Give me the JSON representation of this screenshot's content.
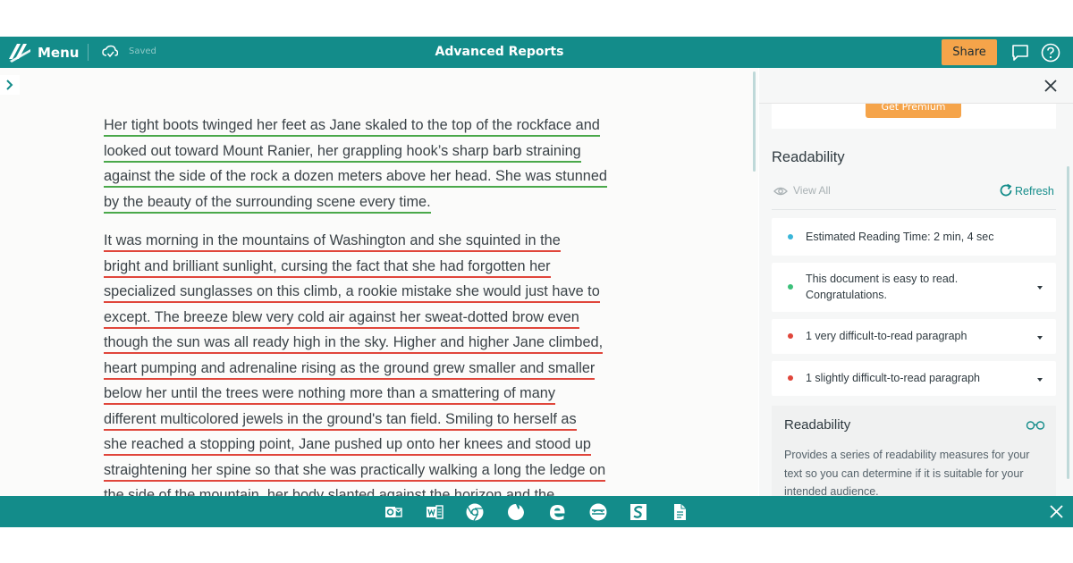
{
  "header": {
    "menu_label": "Menu",
    "saved_label": "Saved",
    "doc_title": "Advanced Reports",
    "share_label": "Share",
    "icons": [
      "logo-icon",
      "cloud-check-icon",
      "chat-icon",
      "help-icon"
    ]
  },
  "document": {
    "paragraphs": [
      {
        "status": "easy",
        "underline_color": "#4aa84a",
        "lines": [
          "Her tight boots twinged her feet as Jane skaled to the top of the rockface and",
          "looked out toward Mount Ranier, her grappling hook’s sharp barb straining",
          "against the side of the rock a dozen meters above her head. She was stunned",
          "by the beauty of the surrounding scene every time."
        ]
      },
      {
        "status": "difficult",
        "underline_color": "#e0463b",
        "lines": [
          "It was morning in the mountains of Washington and she squinted in the",
          "bright and brilliant sunlight, cursing the fact that she had forgotten her",
          "specialized sunglasses on this climb, a rookie mistake she would just have to",
          "except. The breeze blew very cold air against her sweat-dotted brow even",
          "though the sun was all ready high in the sky. Higher and higher Jane climbed,",
          "heart pumping and adrenaline rising as the ground grew smaller and smaller",
          "below her until the trees were nothing more than a smattering of many",
          "different multicolored jewels in the ground's tan field. Smiling to herself as",
          "she reached a stopping point, Jane pushed up onto her knees and stood up",
          "straightening her spine so that she was practically walking a long the ledge on",
          "the side of the mountain, her body slanted against  the horizon and the"
        ]
      }
    ]
  },
  "panel": {
    "premium_label": "Get Premium",
    "title": "Readability",
    "view_all_label": "View All",
    "refresh_label": "Refresh",
    "items": [
      {
        "text": "Estimated Reading Time: 2 min, 4 sec",
        "dot_color": "#3ab6d9",
        "expandable": false
      },
      {
        "text": "This document is easy to read. Congratulations.",
        "dot_color": "#3cc07a",
        "expandable": true
      },
      {
        "text": "1 very difficult-to-read paragraph",
        "dot_color": "#e0463b",
        "expandable": true
      },
      {
        "text": "1 slightly difficult-to-read paragraph",
        "dot_color": "#e0463b",
        "expandable": true
      }
    ],
    "info": {
      "title": "Readability",
      "description": "Provides a series of readability measures for your text so you can determine if it is suitable for your intended audience."
    }
  },
  "integrations_bar": {
    "icons": [
      "outlook-icon",
      "word-icon",
      "chrome-icon",
      "firefox-icon",
      "edge-icon",
      "safari-icon",
      "scrivener-icon",
      "google-docs-icon"
    ]
  },
  "colors": {
    "brand_teal": "#138c8a",
    "accent_orange": "#f5a44a"
  }
}
